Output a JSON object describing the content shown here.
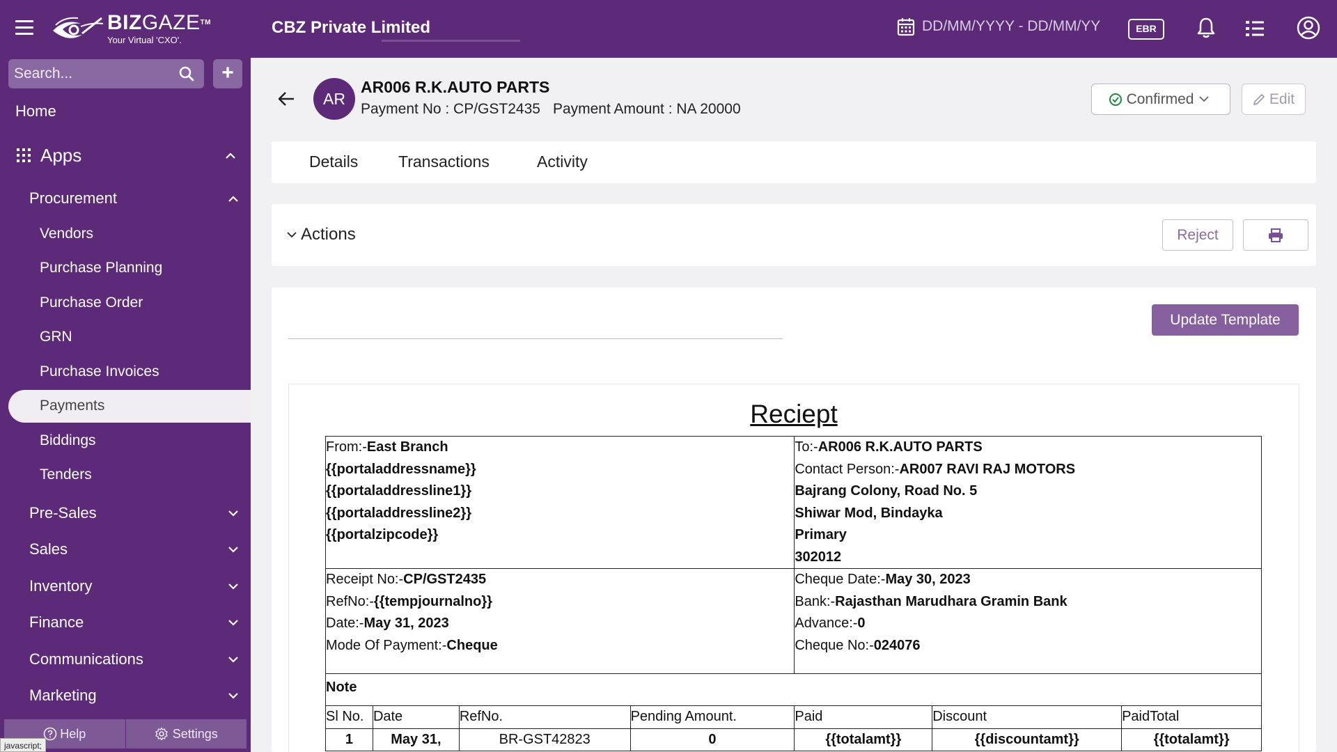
{
  "topbar": {
    "logo_name_a": "BIZ",
    "logo_name_b": "GAZE",
    "logo_tm": "TM",
    "logo_tagline": "Your Virtual 'CXO'.",
    "company": "CBZ Private Limited",
    "date_range": "DD/MM/YYYY - DD/MM/YY",
    "ebr_label": "EBR"
  },
  "sidebar": {
    "search_placeholder": "Search...",
    "add_label": "+",
    "home": "Home",
    "apps": "Apps",
    "procurement": "Procurement",
    "procurement_items": [
      "Vendors",
      "Purchase Planning",
      "Purchase Order",
      "GRN",
      "Purchase Invoices",
      "Payments",
      "Biddings",
      "Tenders"
    ],
    "groups": [
      "Pre-Sales",
      "Sales",
      "Inventory",
      "Finance",
      "Communications",
      "Marketing"
    ],
    "help": "Help",
    "settings": "Settings"
  },
  "status_tip": "javascript;",
  "header": {
    "avatar": "AR",
    "vendor": "AR006 R.K.AUTO PARTS",
    "payment_no": "Payment No : CP/GST2435",
    "payment_amount": "Payment Amount : NA 20000",
    "status": "Confirmed",
    "edit": "Edit"
  },
  "tabs": [
    "Details",
    "Transactions",
    "Activity"
  ],
  "actions": {
    "title": "Actions",
    "reject": "Reject"
  },
  "document": {
    "update_template": "Update Template",
    "title": "Reciept",
    "from_label": "From:-",
    "from_value": "East Branch",
    "from_lines": [
      "{{portaladdressname}}",
      "{{portaladdressline1}}",
      "{{portaladdressline2}}",
      "{{portalzipcode}}"
    ],
    "to_label": "To:-",
    "to_value": "AR006 R.K.AUTO PARTS",
    "contact_label": "Contact Person:-",
    "contact_value": "AR007 RAVI RAJ MOTORS",
    "to_lines": [
      "Bajrang Colony, Road No. 5",
      "Shiwar Mod, Bindayka",
      "Primary",
      "302012"
    ],
    "receipt_no_label": "Receipt No:-",
    "receipt_no": "CP/GST2435",
    "refno_label": "RefNo:-",
    "refno": "{{tempjournalno}}",
    "date_label": "Date:-",
    "date": "May 31, 2023",
    "mode_label": "Mode Of Payment:-",
    "mode": "Cheque",
    "cheque_date_label": "Cheque Date:-",
    "cheque_date": "May 30, 2023",
    "bank_label": "Bank:-",
    "bank": "Rajasthan Marudhara Gramin Bank",
    "advance_label": "Advance:-",
    "advance": "0",
    "cheque_no_label": "Cheque No:-",
    "cheque_no": "024076",
    "note": "Note",
    "columns": [
      "Sl No.",
      "Date",
      "RefNo.",
      "Pending Amount.",
      "Paid",
      "Discount",
      "PaidTotal"
    ],
    "rows": [
      {
        "sl": "1",
        "date": "May 31,",
        "ref": "BR-GST42823",
        "pending": "0",
        "paid": "{{totalamt}}",
        "discount": "{{discountamt}}",
        "paid_total": "{{totalamt}}"
      }
    ]
  }
}
